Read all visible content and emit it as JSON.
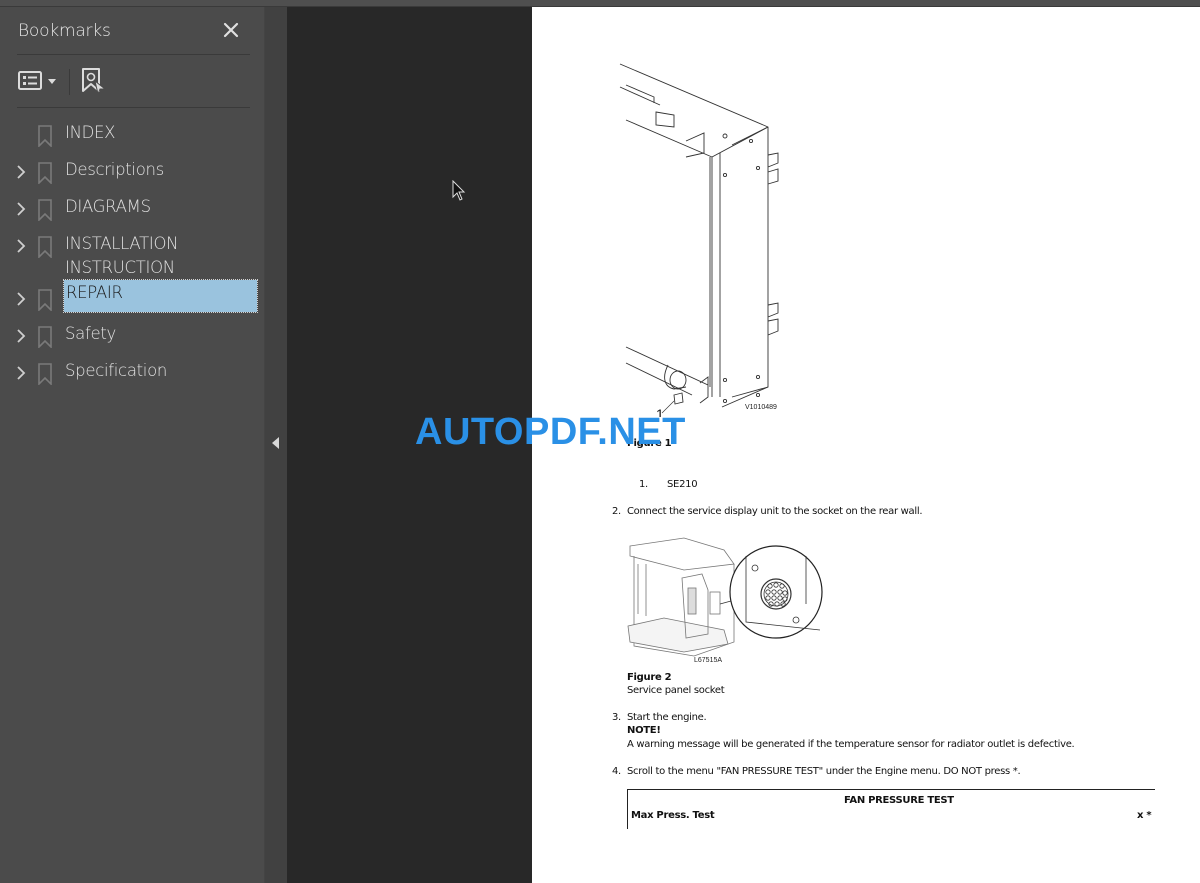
{
  "sidebar": {
    "title": "Bookmarks",
    "close_icon": "close-icon",
    "tools": {
      "options_icon": "list-options-icon",
      "find_bookmark_icon": "find-current-bookmark-icon"
    },
    "items": [
      {
        "label": "INDEX",
        "expandable": false,
        "selected": false
      },
      {
        "label": "Descriptions",
        "expandable": true,
        "selected": false
      },
      {
        "label": "DIAGRAMS",
        "expandable": true,
        "selected": false
      },
      {
        "label": "INSTALLATION INSTRUCTION",
        "line1": "INSTALLATION",
        "line2": "INSTRUCTION",
        "expandable": true,
        "selected": false
      },
      {
        "label": "REPAIR",
        "expandable": true,
        "selected": true
      },
      {
        "label": "Safety",
        "expandable": true,
        "selected": false
      },
      {
        "label": "Specification",
        "expandable": true,
        "selected": false
      }
    ],
    "selected_color": "#9ac3de"
  },
  "watermark": {
    "text": "AUTOPDF.NET",
    "color": "#2a90e6"
  },
  "document": {
    "figure1": {
      "code": "V1010489",
      "callout": "1",
      "caption": "Figure 1",
      "legend_num": "1.",
      "legend_text": "SE210"
    },
    "steps": [
      {
        "num": "2.",
        "text": "Connect the service display unit to the socket on the rear wall."
      },
      {
        "num": "3.",
        "text": "Start the engine.",
        "note_label": "NOTE!",
        "note_text": "A warning message will be generated if the temperature sensor for radiator outlet is defective."
      },
      {
        "num": "4.",
        "text": "Scroll to the menu \"FAN PRESSURE TEST\" under the Engine menu. DO NOT press *."
      }
    ],
    "figure2": {
      "code": "L67515A",
      "caption": "Figure 2",
      "subtitle": "Service panel socket"
    },
    "display_table": {
      "title": "FAN PRESSURE TEST",
      "row_label": "Max Press. Test",
      "row_value": "x *"
    }
  }
}
